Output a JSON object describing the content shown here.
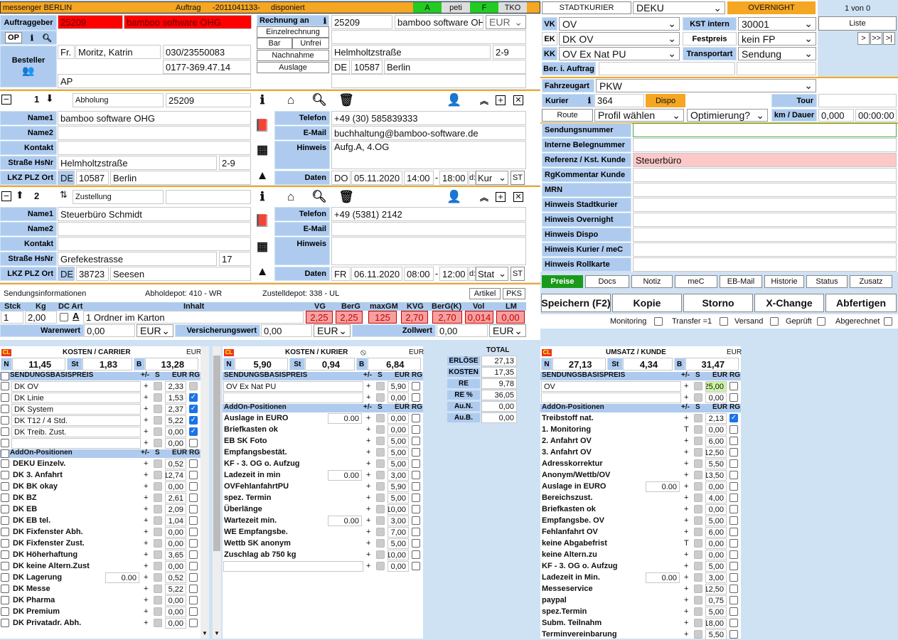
{
  "topbar": {
    "left": "messenger BERLIN",
    "auftrag_label": "Auftrag",
    "auftrag_no": "-2011041133-",
    "status": "disponiert",
    "a": "A",
    "peti": "peti",
    "f": "F",
    "tko": "TKO"
  },
  "auftraggeber": {
    "label": "Auftraggeber",
    "number": "25209",
    "name": "bamboo software OHG",
    "op": "OP",
    "besteller": "Besteller",
    "anrede": "Fr.",
    "person": "Moritz, Katrin",
    "phone1": "030/23550083",
    "phone2": "0177-369.47.14",
    "ap": "AP"
  },
  "rechnung": {
    "rechnung_an": "Rechnung an",
    "einzel": "Einzelrechnung",
    "bar": "Bar",
    "unfrei": "Unfrei",
    "nachnahme": "Nachnahme",
    "auslage": "Auslage",
    "num": "25209",
    "name": "bamboo software OHG",
    "currency": "EUR",
    "street": "Helmholtzstraße",
    "hsnr": "2-9",
    "country": "DE",
    "plz": "10587",
    "city": "Berlin"
  },
  "stop1": {
    "num": "1",
    "type": "Abholung",
    "ref": "25209",
    "name1": "bamboo software OHG",
    "name2": "",
    "kontakt": "",
    "strasse": "Helmholtzstraße",
    "hsnr": "2-9",
    "lkz": "DE",
    "plz": "10587",
    "ort": "Berlin",
    "telefon": "+49 (30) 585839333",
    "email": "buchhaltung@bamboo-software.de",
    "hinweis": "Aufg.A, 4.OG",
    "day": "DO",
    "date": "05.11.2020",
    "from": "14:00",
    "to": "18:00",
    "d": "d:",
    "mode": "Kur"
  },
  "stop2": {
    "num": "2",
    "type": "Zustellung",
    "ref": "",
    "name1": "Steuerbüro Schmidt",
    "name2": "",
    "kontakt": "",
    "strasse": "Grefekestrasse",
    "hsnr": "17",
    "lkz": "DE",
    "plz": "38723",
    "ort": "Seesen",
    "telefon": "+49 (5381) 2142",
    "email": "",
    "hinweis": "",
    "day": "FR",
    "date": "06.11.2020",
    "from": "08:00",
    "to": "12:00",
    "d": "d:",
    "mode": "Stat"
  },
  "labels": {
    "name1": "Name1",
    "name2": "Name2",
    "kontakt": "Kontakt",
    "strasse": "Straße HsNr",
    "lkz": "LKZ PLZ Ort",
    "telefon": "Telefon",
    "email": "E-Mail",
    "hinweis": "Hinweis",
    "daten": "Daten",
    "st": "ST",
    "dash": "-"
  },
  "sendung": {
    "info": "Sendungsinformationen",
    "abholdepot": "Abholdepot: 410 - WR",
    "zustelldepot": "Zustelldepot: 338 - UL",
    "artikel": "Artikel",
    "pks": "PKS",
    "h_stck": "Stck",
    "h_kg": "Kg",
    "h_dc": "DC Art",
    "h_inhalt": "Inhalt",
    "h_vg": "VG",
    "h_berg": "BerG",
    "h_maxgm": "maxGM",
    "h_kvg": "KVG",
    "h_bergk": "BerG(K)",
    "h_vol": "Vol",
    "h_lm": "LM",
    "stck": "1",
    "kg": "2,00",
    "inhalt": "1 Ordner im Karton",
    "vg": "2,25",
    "berg": "2,25",
    "maxgm": "125",
    "kvg": "2,70",
    "bergk": "2,70",
    "vol": "0,014",
    "lm": "0,00",
    "warenwert_l": "Warenwert",
    "warenwert": "0,00",
    "eur": "EUR",
    "versich_l": "Versicherungswert",
    "versich": "0,00",
    "zoll_l": "Zollwert",
    "zoll": "0,00"
  },
  "right": {
    "stadtkurier": "STADTKURIER",
    "deku": "DEKU",
    "overnight": "OVERNIGHT",
    "count": "1 von 0",
    "liste": "Liste",
    "vk": "VK",
    "vk_val": "OV",
    "ek": "EK",
    "ek_val": "DK OV",
    "kk": "KK",
    "kk_val": "OV Ex Nat PU",
    "kst_l": "KST intern",
    "kst": "30001",
    "festpreis_l": "Festpreis",
    "festpreis": "kein FP",
    "transportart_l": "Transportart",
    "transportart": "Sendung",
    "ber": "Ber. i. Auftrag",
    "fahrzeugart_l": "Fahrzeugart",
    "fahrzeugart": "PKW",
    "kurier_l": "Kurier",
    "kurier": "364",
    "dispo": "Dispo",
    "tour": "Tour",
    "route": "Route",
    "profil": "Profil wählen",
    "optim": "Optimierung?",
    "kmdauer": "km / Dauer",
    "km": "0,000",
    "dauer": "00:00:00",
    "nav1": ">",
    "nav2": ">>",
    "nav3": ">|"
  },
  "refs": [
    {
      "label": "Sendungsnummer",
      "val": ""
    },
    {
      "label": "Interne Belegnummer",
      "val": ""
    },
    {
      "label": "Referenz / Kst. Kunde",
      "val": "Steuerbüro"
    },
    {
      "label": "RgKommentar Kunde",
      "val": ""
    },
    {
      "label": "MRN",
      "val": ""
    },
    {
      "label": "Hinweis Stadtkurier",
      "val": ""
    },
    {
      "label": "Hinweis Overnight",
      "val": ""
    },
    {
      "label": "Hinweis Dispo",
      "val": ""
    },
    {
      "label": "Hinweis Kurier / meC",
      "val": ""
    },
    {
      "label": "Hinweis Rollkarte",
      "val": ""
    }
  ],
  "tabs": [
    "Preise",
    "Docs",
    "Notiz",
    "meC",
    "EB-Mail",
    "Historie",
    "Status",
    "Zusatz"
  ],
  "actions": [
    "Speichern (F2)",
    "Kopie",
    "Storno",
    "X-Change",
    "Abfertigen"
  ],
  "checks": [
    "Monitoring",
    "Transfer =1",
    "Versand",
    "Geprüft",
    "Abgerechnet"
  ],
  "kosten_carrier": {
    "title": "KOSTEN / CARRIER",
    "cur": "EUR",
    "n": "11,45",
    "st": "1,83",
    "b": "13,28",
    "basis": "SENDUNGSBASISPREIS",
    "addon": "AddOn-Positionen",
    "pm": "+/-",
    "s": "S",
    "eur": "EUR",
    "rg": "RG",
    "basis_rows": [
      {
        "name": "DK OV",
        "val": "2,33",
        "rg": false
      },
      {
        "name": "DK Linie",
        "val": "1,53",
        "rg": true
      },
      {
        "name": "DK System",
        "val": "2,37",
        "rg": true
      },
      {
        "name": "DK T12 / 4 Std.",
        "val": "5,22",
        "rg": true
      },
      {
        "name": "DK Treib. Zust.",
        "val": "0,00",
        "rg": true
      },
      {
        "name": "",
        "val": "0,00",
        "rg": false
      }
    ],
    "addons": [
      {
        "name": "DEKU Einzelv.",
        "in": "",
        "val": "0,52"
      },
      {
        "name": "DK 3. Anfahrt",
        "in": "",
        "val": "12,74"
      },
      {
        "name": "DK BK okay",
        "in": "",
        "val": "0,00"
      },
      {
        "name": "DK BZ",
        "in": "",
        "val": "2,61"
      },
      {
        "name": "DK EB",
        "in": "",
        "val": "2,09"
      },
      {
        "name": "DK EB tel.",
        "in": "",
        "val": "1,04"
      },
      {
        "name": "DK Fixfenster Abh.",
        "in": "",
        "val": "0,00"
      },
      {
        "name": "DK Fixfenster Zust.",
        "in": "",
        "val": "0,00"
      },
      {
        "name": "DK Höherhaftung",
        "in": "",
        "val": "3,65"
      },
      {
        "name": "DK keine Altern.Zust",
        "in": "",
        "val": "0,00"
      },
      {
        "name": "DK Lagerung",
        "in": "0.00",
        "val": "0,52"
      },
      {
        "name": "DK Messe",
        "in": "",
        "val": "5,22"
      },
      {
        "name": "DK Pharma",
        "in": "",
        "val": "0,00"
      },
      {
        "name": "DK Premium",
        "in": "",
        "val": "0,00"
      },
      {
        "name": "DK Privatadr. Abh.",
        "in": "",
        "val": "0,00"
      }
    ]
  },
  "kosten_kurier": {
    "title": "KOSTEN / KURIER",
    "cur": "EUR",
    "n": "5,90",
    "st": "0,94",
    "b": "6,84",
    "basis": "SENDUNGSBASISPREIS",
    "addon": "AddOn-Positionen",
    "pm": "+/-",
    "s": "S",
    "eur": "EUR",
    "rg": "RG",
    "basis_rows": [
      {
        "name": "OV Ex Nat PU",
        "val": "5,90"
      },
      {
        "name": "",
        "val": "0,00"
      }
    ],
    "addons": [
      {
        "name": "Auslage in EURO",
        "in": "0.00",
        "val": "0,00"
      },
      {
        "name": "Briefkasten ok",
        "in": "",
        "val": "0,00"
      },
      {
        "name": "EB SK Foto",
        "in": "",
        "val": "5,00"
      },
      {
        "name": "Empfangsbestät.",
        "in": "",
        "val": "5,00"
      },
      {
        "name": "KF - 3. OG o. Aufzug",
        "in": "",
        "val": "5,00"
      },
      {
        "name": "Ladezeit in min",
        "in": "0.00",
        "val": "3,00"
      },
      {
        "name": "OVFehlanfahrtPU",
        "in": "",
        "val": "5,90"
      },
      {
        "name": "spez. Termin",
        "in": "",
        "val": "5,00"
      },
      {
        "name": "Überlänge",
        "in": "",
        "val": "10,00"
      },
      {
        "name": "Wartezeit min.",
        "in": "0.00",
        "val": "3,00"
      },
      {
        "name": "WE Empfangsbe.",
        "in": "",
        "val": "7,00"
      },
      {
        "name": "Wettb SK anonym",
        "in": "",
        "val": "5,00"
      },
      {
        "name": "Zuschlag ab 750 kg",
        "in": "",
        "val": "10,00"
      },
      {
        "name": "",
        "in": "",
        "val": "0,00"
      }
    ]
  },
  "total": {
    "title": "TOTAL",
    "rows": [
      {
        "label": "ERLÖSE",
        "val": "27,13"
      },
      {
        "label": "KOSTEN",
        "val": "17,35"
      },
      {
        "label": "RE",
        "val": "9,78"
      },
      {
        "label": "RE %",
        "val": "36,05"
      },
      {
        "label": "Au.N.",
        "val": "0,00"
      },
      {
        "label": "Au.B.",
        "val": "0,00"
      }
    ]
  },
  "umsatz": {
    "title": "UMSATZ / KUNDE",
    "cur": "EUR",
    "n": "27,13",
    "st": "4,34",
    "b": "31,47",
    "basis": "SENDUNGSBASISPREIS",
    "addon": "AddOn-Positionen",
    "pm": "+/-",
    "s": "S",
    "eur": "EUR",
    "rg": "RG",
    "basis_rows": [
      {
        "name": "OV",
        "val": "25,00"
      },
      {
        "name": "",
        "val": "0,00"
      }
    ],
    "addons": [
      {
        "name": "Treibstoff nat.",
        "in": "",
        "t": "+",
        "val": "2,13",
        "rg": true
      },
      {
        "name": "1. Monitoring",
        "in": "",
        "t": "T",
        "val": "0,00"
      },
      {
        "name": "2. Anfahrt OV",
        "in": "",
        "t": "+",
        "val": "6,00"
      },
      {
        "name": "3. Anfahrt OV",
        "in": "",
        "t": "+",
        "val": "12,50"
      },
      {
        "name": "Adresskorrektur",
        "in": "",
        "t": "+",
        "val": "5,50"
      },
      {
        "name": "Anonym/Wettb/OV",
        "in": "",
        "t": "+",
        "val": "13,50"
      },
      {
        "name": "Auslage in EURO",
        "in": "0.00",
        "t": "+",
        "val": "0,00"
      },
      {
        "name": "Bereichszust.",
        "in": "",
        "t": "+",
        "val": "4,00"
      },
      {
        "name": "Briefkasten ok",
        "in": "",
        "t": "+",
        "val": "0,00"
      },
      {
        "name": "Empfangsbe. OV",
        "in": "",
        "t": "+",
        "val": "5,00"
      },
      {
        "name": "Fehlanfahrt OV",
        "in": "",
        "t": "+",
        "val": "6,00"
      },
      {
        "name": "keine Abgabefrist",
        "in": "",
        "t": "T",
        "val": "0,00"
      },
      {
        "name": "keine Altern.zu",
        "in": "",
        "t": "+",
        "val": "0,00"
      },
      {
        "name": "KF - 3. OG o. Aufzug",
        "in": "",
        "t": "+",
        "val": "5,00"
      },
      {
        "name": "Ladezeit in Min.",
        "in": "0.00",
        "t": "+",
        "val": "3,00"
      },
      {
        "name": "Messeservice",
        "in": "",
        "t": "+",
        "val": "12,50"
      },
      {
        "name": "paypal",
        "in": "",
        "t": "+",
        "val": "0,75"
      },
      {
        "name": "spez.Termin",
        "in": "",
        "t": "+",
        "val": "5,00"
      },
      {
        "name": "Subm. Teilnahm",
        "in": "",
        "t": "+",
        "val": "18,00"
      },
      {
        "name": "Terminvereinbarung",
        "in": "",
        "t": "+",
        "val": "5,50"
      }
    ]
  }
}
